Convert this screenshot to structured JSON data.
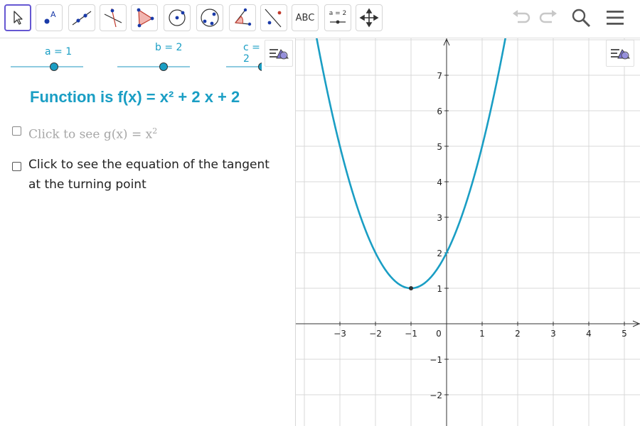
{
  "toolbar": {
    "tools": [
      {
        "name": "move-tool"
      },
      {
        "name": "point-tool",
        "label": "A"
      },
      {
        "name": "line-tool"
      },
      {
        "name": "perpendicular-line-tool"
      },
      {
        "name": "polygon-tool"
      },
      {
        "name": "circle-with-center-tool"
      },
      {
        "name": "circle-through-points-tool"
      },
      {
        "name": "angle-tool"
      },
      {
        "name": "reflect-tool"
      },
      {
        "name": "text-tool",
        "label": "ABC"
      },
      {
        "name": "slider-tool",
        "label": "a = 2"
      },
      {
        "name": "move-graphics-view-tool"
      }
    ],
    "right": [
      "undo-icon",
      "redo-icon",
      "search-icon",
      "menu-icon"
    ]
  },
  "algebra": {
    "sliders": [
      {
        "label": "a = 1",
        "value": 1
      },
      {
        "label": "b = 2",
        "value": 2
      },
      {
        "label": "c = 2",
        "value": 2
      }
    ],
    "function_text": "Function is f(x) = x² + 2 x + 2",
    "checkbox1": {
      "text": "Click to see g(x) = x",
      "sup": "2",
      "checked": false
    },
    "checkbox2": {
      "line1": "Click to see the equation of the tangent",
      "line2": "at the turning point",
      "checked": false
    }
  },
  "graph": {
    "x_ticks": [
      "−3",
      "−2",
      "−1",
      "0",
      "1",
      "2",
      "3",
      "4",
      "5"
    ],
    "y_ticks": [
      "7",
      "6",
      "5",
      "4",
      "3",
      "2",
      "1",
      "−1",
      "−2"
    ],
    "curve_color": "#1a9ec4",
    "vertex": {
      "x": -1,
      "y": 1
    }
  },
  "colors": {
    "accent": "#1a9ec4",
    "selected_border": "#6557d2",
    "grid": "#d9d9d9"
  }
}
